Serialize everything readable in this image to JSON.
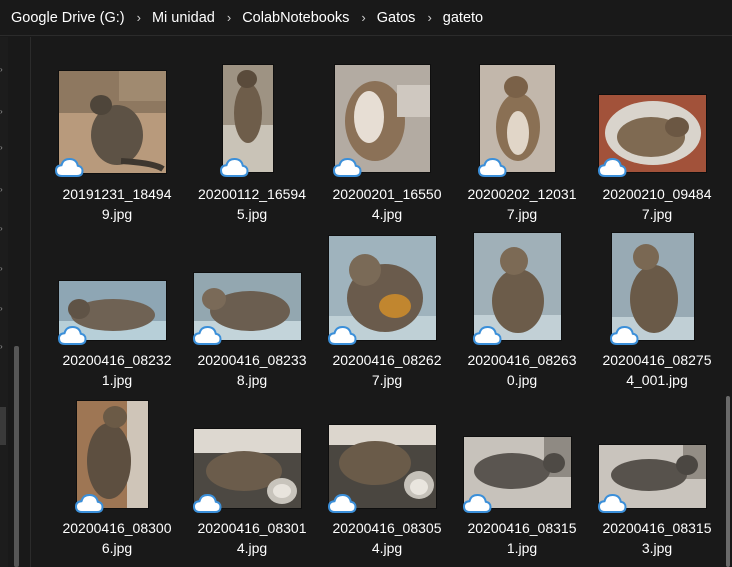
{
  "breadcrumb": {
    "items": [
      "Google Drive (G:)",
      "Mi unidad",
      "ColabNotebooks",
      "Gatos",
      "gateto"
    ],
    "separator": "›"
  },
  "files": [
    {
      "name_line1": "20191231_18494",
      "name_line2": "9.jpg",
      "status_icon": "cloud-icon"
    },
    {
      "name_line1": "20200112_16594",
      "name_line2": "5.jpg",
      "status_icon": "cloud-icon"
    },
    {
      "name_line1": "20200201_16550",
      "name_line2": "4.jpg",
      "status_icon": "cloud-icon"
    },
    {
      "name_line1": "20200202_12031",
      "name_line2": "7.jpg",
      "status_icon": "cloud-icon"
    },
    {
      "name_line1": "20200210_09484",
      "name_line2": "7.jpg",
      "status_icon": "cloud-icon"
    },
    {
      "name_line1": "20200416_08232",
      "name_line2": "1.jpg",
      "status_icon": "cloud-icon"
    },
    {
      "name_line1": "20200416_08233",
      "name_line2": "8.jpg",
      "status_icon": "cloud-icon"
    },
    {
      "name_line1": "20200416_08262",
      "name_line2": "7.jpg",
      "status_icon": "cloud-icon"
    },
    {
      "name_line1": "20200416_08263",
      "name_line2": "0.jpg",
      "status_icon": "cloud-icon"
    },
    {
      "name_line1": "20200416_08275",
      "name_line2": "4_001.jpg",
      "status_icon": "cloud-icon"
    },
    {
      "name_line1": "20200416_08300",
      "name_line2": "6.jpg",
      "status_icon": "cloud-icon"
    },
    {
      "name_line1": "20200416_08301",
      "name_line2": "4.jpg",
      "status_icon": "cloud-icon"
    },
    {
      "name_line1": "20200416_08305",
      "name_line2": "4.jpg",
      "status_icon": "cloud-icon"
    },
    {
      "name_line1": "20200416_08315",
      "name_line2": "1.jpg",
      "status_icon": "cloud-icon"
    },
    {
      "name_line1": "20200416_08315",
      "name_line2": "3.jpg",
      "status_icon": "cloud-icon"
    }
  ],
  "colors": {
    "background": "#191919",
    "text": "#ffffff",
    "cloud_stroke": "#3b8fd9",
    "cloud_fill": "#ffffff"
  }
}
